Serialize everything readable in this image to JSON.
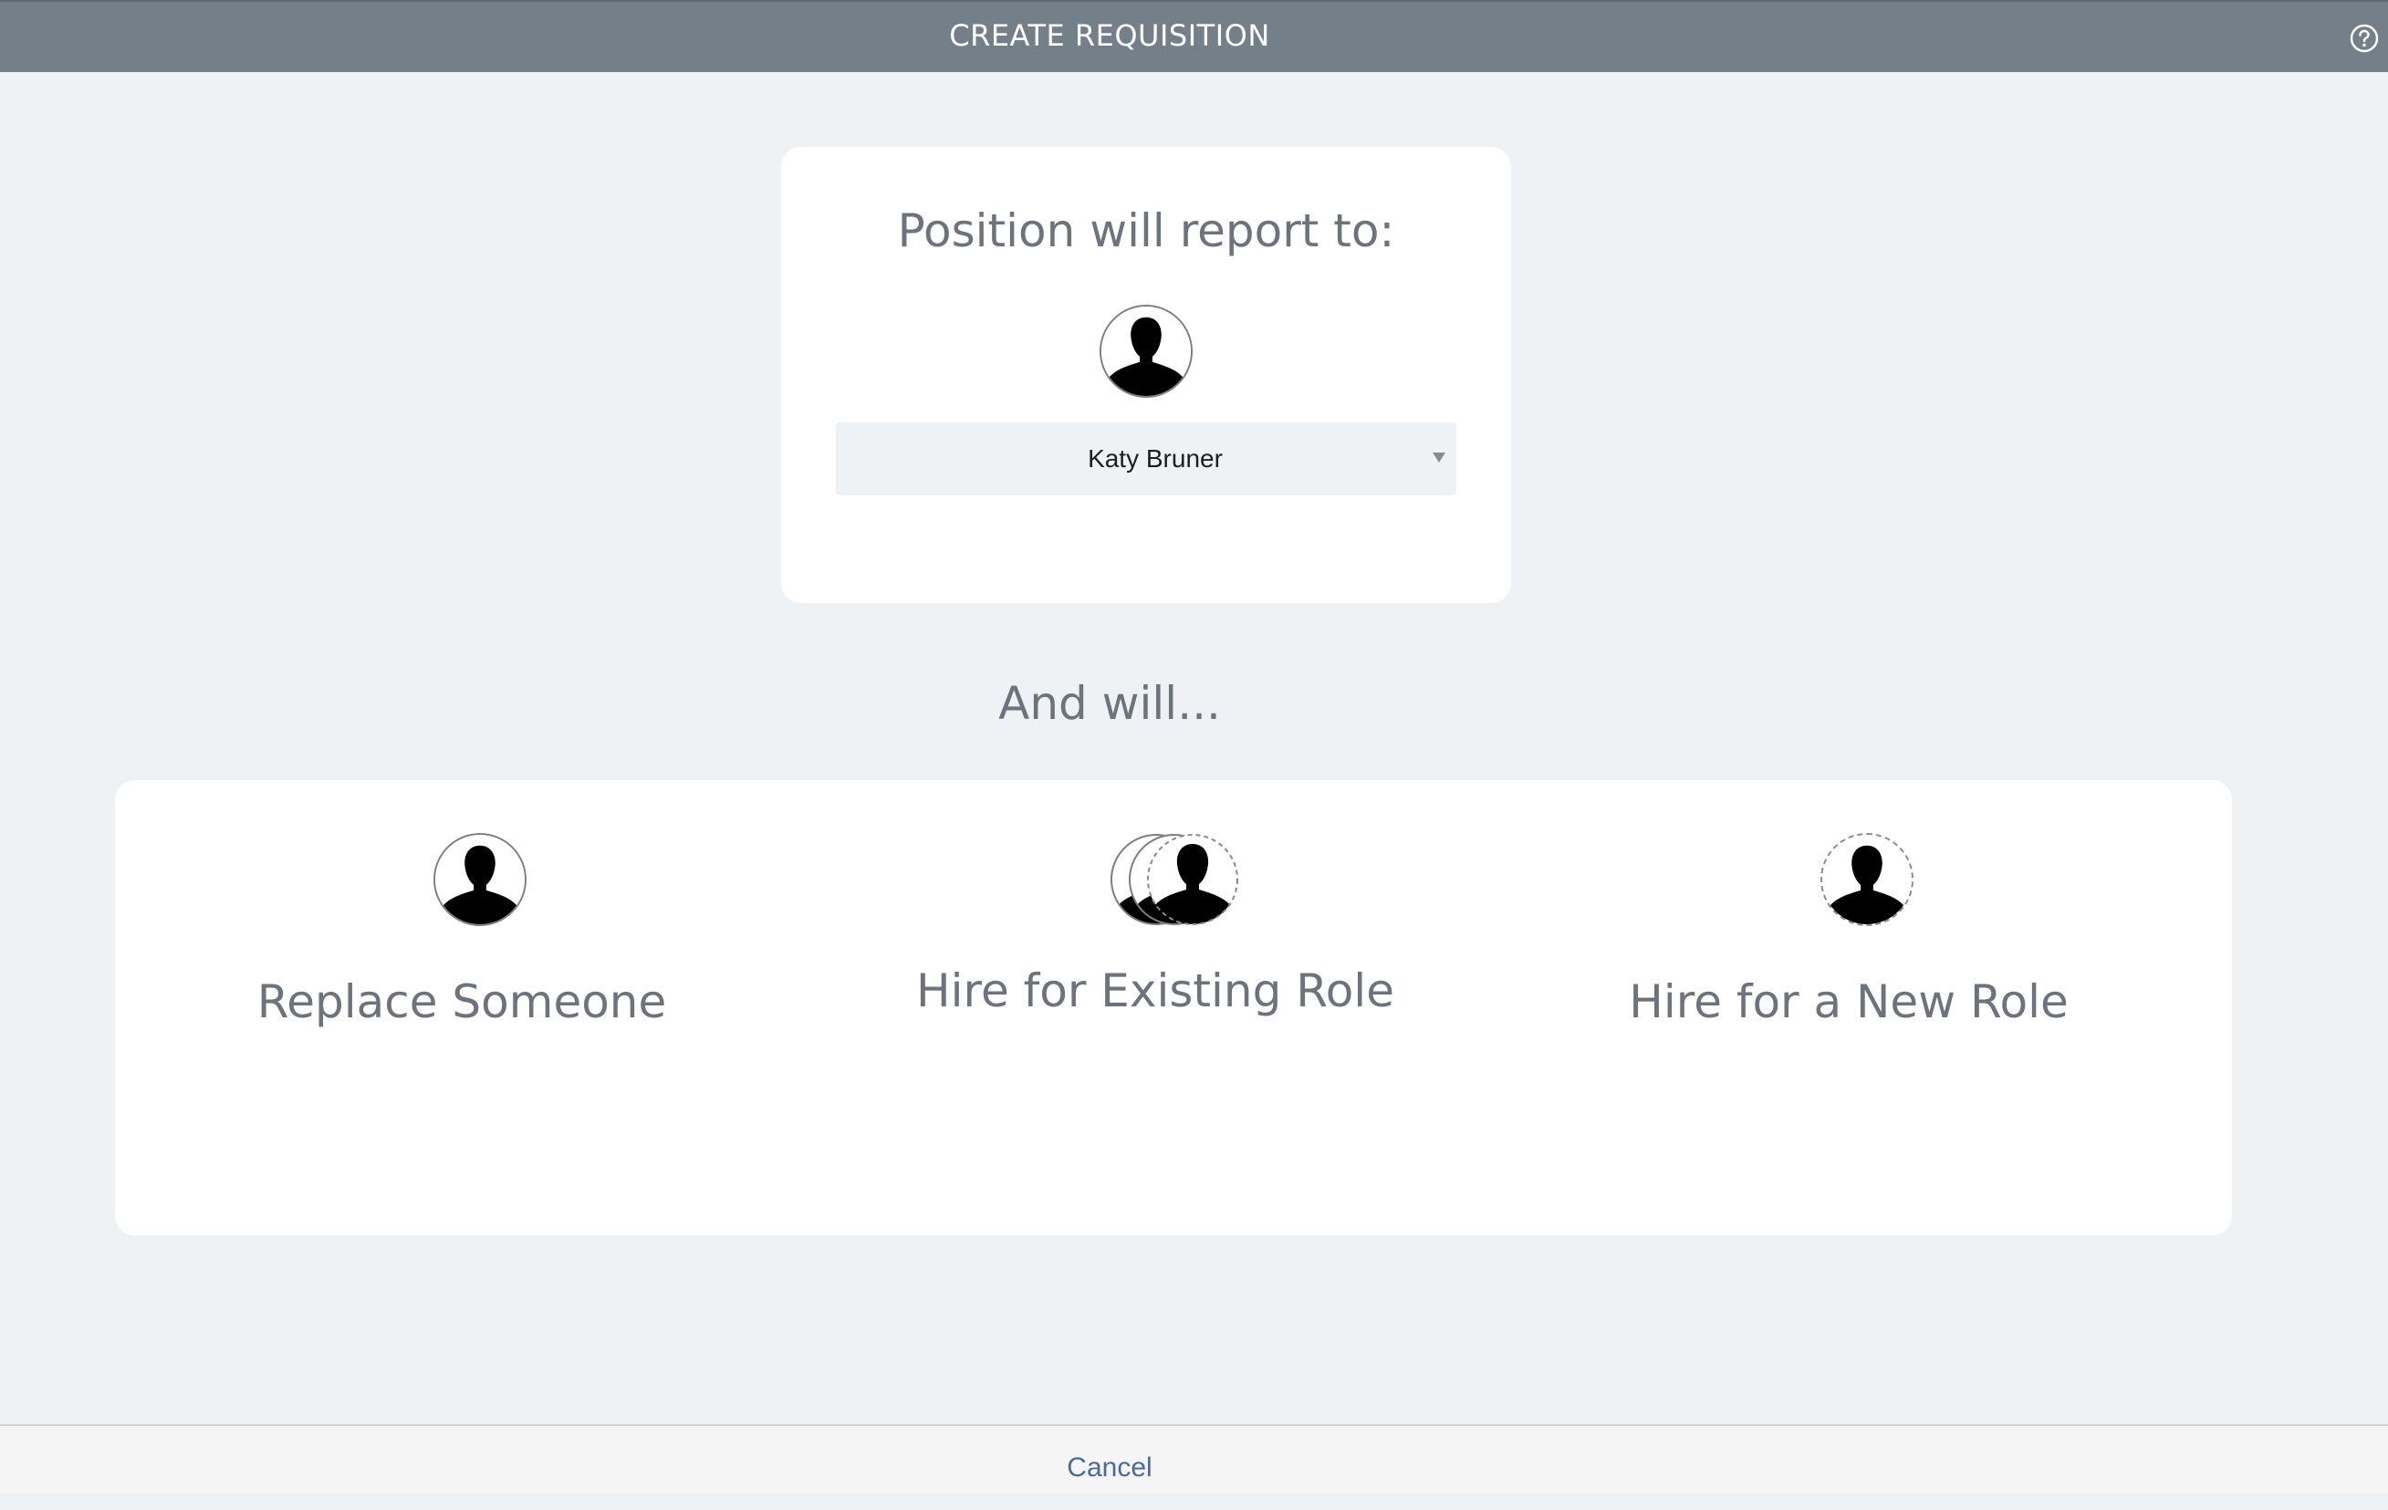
{
  "header": {
    "title": "CREATE REQUISITION",
    "help_icon": "help-circle-icon"
  },
  "report_to": {
    "title": "Position will report to:",
    "avatar_icon": "person-silhouette-icon",
    "selected_manager": "Katy Bruner"
  },
  "options_heading": "And will...",
  "options": [
    {
      "label": "Replace Someone",
      "icon": "person-silhouette-icon"
    },
    {
      "label": "Hire for Existing Role",
      "icon": "multiple-people-icon"
    },
    {
      "label": "Hire for a New Role",
      "icon": "new-person-dashed-icon"
    }
  ],
  "footer": {
    "cancel_label": "Cancel"
  },
  "colors": {
    "header_bg": "#73808a",
    "page_bg": "#eff2f5",
    "heading_text": "#6c737d",
    "link": "#4a6a9a"
  }
}
